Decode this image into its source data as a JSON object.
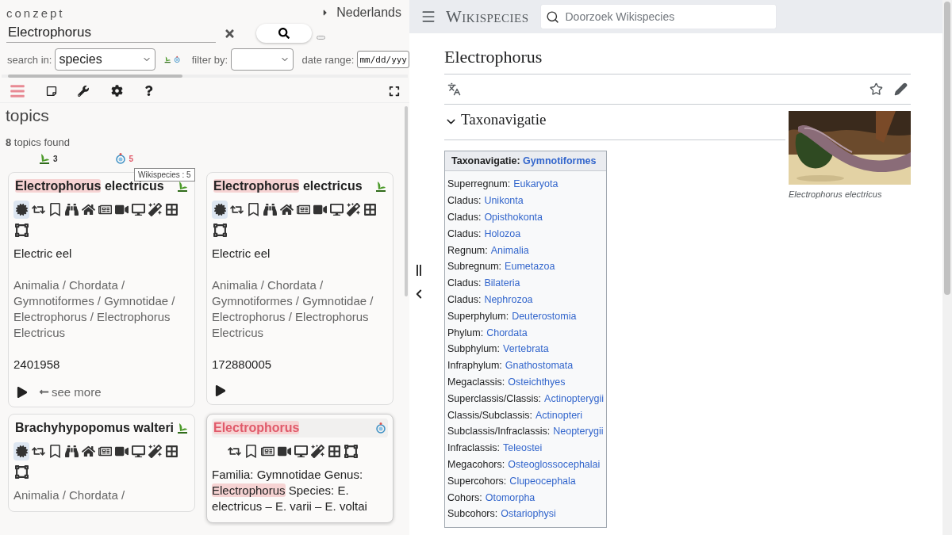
{
  "app": {
    "brand": "conzept",
    "language": "Nederlands",
    "search": {
      "value": "Electrophorus"
    },
    "filters": {
      "search_in_label": "search in:",
      "search_in_value": "species",
      "filter_by_label": "filter by:",
      "date_range_label": "date range:",
      "date_placeholder": "mm/dd/yyy"
    },
    "results": {
      "heading": "topics",
      "found": "**8** topics found",
      "sources": [
        {
          "kind": "gbif",
          "count": "3",
          "color": "#333333"
        },
        {
          "kind": "wikispecies",
          "count": "5",
          "color": "#e05a6a"
        }
      ],
      "tooltip": "Wikispecies : 5",
      "cards": [
        {
          "kind": "gbif",
          "selected": false,
          "title": [
            {
              "text": "Electrophorus",
              "highlighted": true
            },
            {
              "text": " electricus",
              "highlighted": false
            }
          ],
          "actions": [
            {
              "kind": "concept",
              "selected": true
            },
            {
              "kind": "repeat",
              "selected": false
            },
            {
              "kind": "bookmark",
              "selected": false
            },
            {
              "kind": "binoculars",
              "selected": false
            },
            {
              "kind": "home",
              "selected": false
            },
            {
              "kind": "news",
              "selected": false
            },
            {
              "kind": "video",
              "selected": false
            },
            {
              "kind": "desktop",
              "selected": false
            },
            {
              "kind": "wand",
              "selected": false
            },
            {
              "kind": "grid",
              "selected": false
            },
            {
              "kind": "frame",
              "selected": false
            }
          ],
          "common_name": "Electric eel",
          "taxonomy": "Animalia / Chordata / Gymnotiformes / Gymnotidae / Electrophorus / Electrophorus Electricus",
          "id": "2401958",
          "see_more": "see more"
        },
        {
          "kind": "gbif",
          "selected": false,
          "title": [
            {
              "text": "Electrophorus",
              "highlighted": true
            },
            {
              "text": " electricus",
              "highlighted": false
            }
          ],
          "actions": [
            {
              "kind": "concept",
              "selected": true
            },
            {
              "kind": "repeat",
              "selected": false
            },
            {
              "kind": "bookmark",
              "selected": false
            },
            {
              "kind": "binoculars",
              "selected": false
            },
            {
              "kind": "home",
              "selected": false
            },
            {
              "kind": "news",
              "selected": false
            },
            {
              "kind": "video",
              "selected": false
            },
            {
              "kind": "desktop",
              "selected": false
            },
            {
              "kind": "wand",
              "selected": false
            },
            {
              "kind": "grid",
              "selected": false
            },
            {
              "kind": "frame",
              "selected": false
            }
          ],
          "common_name": "Electric eel",
          "taxonomy": "Animalia / Chordata / Gymnotiformes / Gymnotidae / Electrophorus / Electrophorus Electricus",
          "id": "172880005"
        },
        {
          "kind": "gbif",
          "selected": false,
          "title": [
            {
              "text": "Brachyhypopomus walteri",
              "highlighted": false
            }
          ],
          "actions": [
            {
              "kind": "concept",
              "selected": true
            },
            {
              "kind": "repeat",
              "selected": false
            },
            {
              "kind": "bookmark",
              "selected": false
            },
            {
              "kind": "binoculars",
              "selected": false
            },
            {
              "kind": "home",
              "selected": false
            },
            {
              "kind": "news",
              "selected": false
            },
            {
              "kind": "video",
              "selected": false
            },
            {
              "kind": "desktop",
              "selected": false
            },
            {
              "kind": "wand",
              "selected": false
            },
            {
              "kind": "grid",
              "selected": false
            },
            {
              "kind": "frame",
              "selected": false
            }
          ],
          "taxonomy": "Animalia / Chordata /"
        },
        {
          "kind": "wikispecies",
          "selected": true,
          "title": [
            {
              "text": "Electrophorus",
              "highlighted": true
            }
          ],
          "actions": [
            {
              "kind": "repeat",
              "selected": false
            },
            {
              "kind": "bookmark",
              "selected": false
            },
            {
              "kind": "news",
              "selected": false
            },
            {
              "kind": "video",
              "selected": false
            },
            {
              "kind": "desktop",
              "selected": false
            },
            {
              "kind": "wand",
              "selected": false
            },
            {
              "kind": "grid",
              "selected": false
            },
            {
              "kind": "frame",
              "selected": false
            }
          ],
          "description": [
            {
              "text": "Familia: Gymnotidae Genus: ",
              "highlighted": false
            },
            {
              "text": "Electrophorus",
              "highlighted": true
            },
            {
              "text": " Species: E. electricus – E. varii – E. voltai",
              "highlighted": false
            }
          ]
        }
      ]
    }
  },
  "wiki": {
    "site": "Wikispecies",
    "search": {
      "placeholder": "Doorzoek Wikispecies"
    },
    "title": "Electrophorus",
    "section": {
      "title": "Taxonavigatie",
      "expanded": true
    },
    "image": {
      "kind": "picture",
      "caption": "Electrophorus electricus"
    },
    "taxobox": {
      "label": "Taxonavigatie:",
      "link": "Gymnotiformes",
      "rows": [
        {
          "rank": "Superregnum:",
          "taxon": "Eukaryota"
        },
        {
          "rank": "Cladus:",
          "taxon": "Unikonta"
        },
        {
          "rank": "Cladus:",
          "taxon": "Opisthokonta"
        },
        {
          "rank": "Cladus:",
          "taxon": "Holozoa"
        },
        {
          "rank": "Regnum:",
          "taxon": "Animalia"
        },
        {
          "rank": "Subregnum:",
          "taxon": "Eumetazoa"
        },
        {
          "rank": "Cladus:",
          "taxon": "Bilateria"
        },
        {
          "rank": "Cladus:",
          "taxon": "Nephrozoa"
        },
        {
          "rank": "Superphylum:",
          "taxon": "Deuterostomia"
        },
        {
          "rank": "Phylum:",
          "taxon": "Chordata"
        },
        {
          "rank": "Subphylum:",
          "taxon": "Vertebrata"
        },
        {
          "rank": "Infraphylum:",
          "taxon": "Gnathostomata"
        },
        {
          "rank": "Megaclassis:",
          "taxon": "Osteichthyes"
        },
        {
          "rank": "Superclassis/Classis:",
          "taxon": "Actinopterygii"
        },
        {
          "rank": "Classis/Subclassis:",
          "taxon": "Actinopteri"
        },
        {
          "rank": "Subclassis/Infraclassis:",
          "taxon": "Neopterygii"
        },
        {
          "rank": "Infraclassis:",
          "taxon": "Teleostei"
        },
        {
          "rank": "Megacohors:",
          "taxon": "Osteoglossocephalai"
        },
        {
          "rank": "Supercohors:",
          "taxon": "Clupeocephala"
        },
        {
          "rank": "Cohors:",
          "taxon": "Otomorpha"
        },
        {
          "rank": "Subcohors:",
          "taxon": "Ostariophysi"
        }
      ]
    }
  }
}
